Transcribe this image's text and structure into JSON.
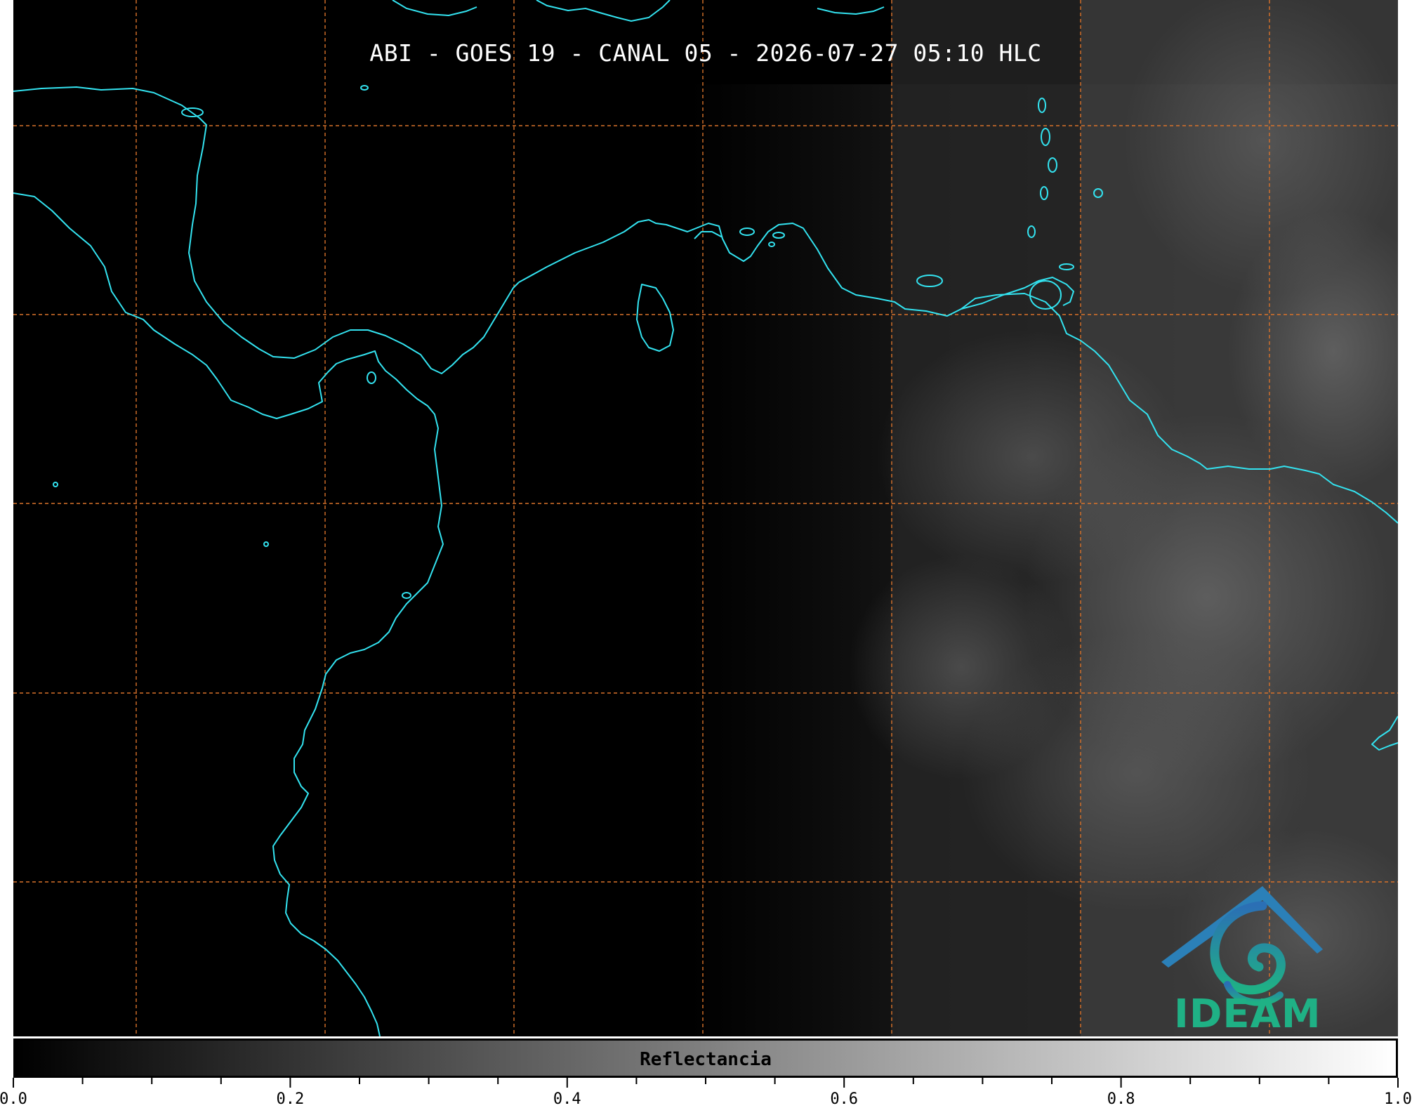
{
  "title": "ABI - GOES 19 - CANAL 05 - 2026-07-27 05:10 HLC",
  "logo_text": "IDEAM",
  "colorbar": {
    "label": "Reflectancia",
    "min": 0.0,
    "max": 1.0,
    "tick_labels": [
      "0.0",
      "0.2",
      "0.4",
      "0.6",
      "0.8",
      "1.0"
    ],
    "colormap": "grayscale black to white"
  },
  "colors": {
    "coastline": "#33e3f0",
    "gridlines": "#d9722a",
    "background": "#000000",
    "logo_blue": "#2b6fb5",
    "logo_green": "#1fb185"
  }
}
